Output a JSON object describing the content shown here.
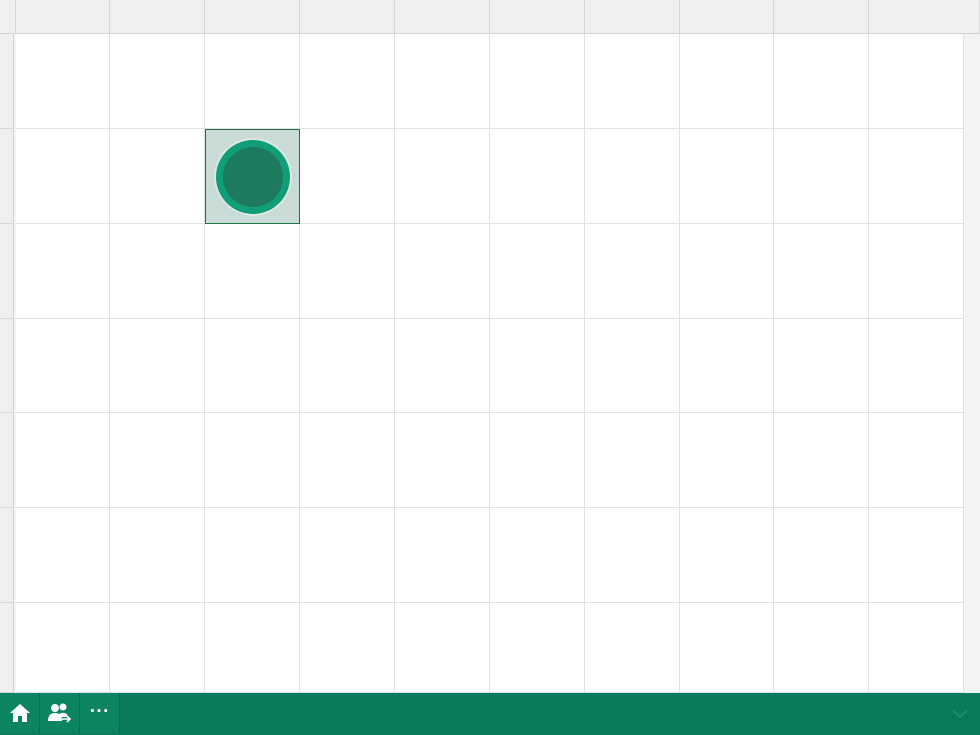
{
  "colors": {
    "accent": "#0a7a5c",
    "selection_fill": "#c9dbd6",
    "selection_border": "#217346",
    "marker_outer": "#0f9e78",
    "marker_inner": "#1d7a5f",
    "gridline": "#e1e1e1"
  },
  "sheet": {
    "column_headers": [
      "",
      "",
      "",
      "",
      "",
      "",
      "",
      "",
      "",
      "",
      ""
    ],
    "row_headers": [
      "",
      "",
      "",
      "",
      "",
      "",
      "",
      ""
    ],
    "selected_cell": {
      "row": 2,
      "col": 3
    }
  },
  "bottom_bar": {
    "home_icon": "home-icon",
    "share_icon": "people-share-icon",
    "more_label": "···",
    "collapse_icon": "chevron-down-icon"
  }
}
